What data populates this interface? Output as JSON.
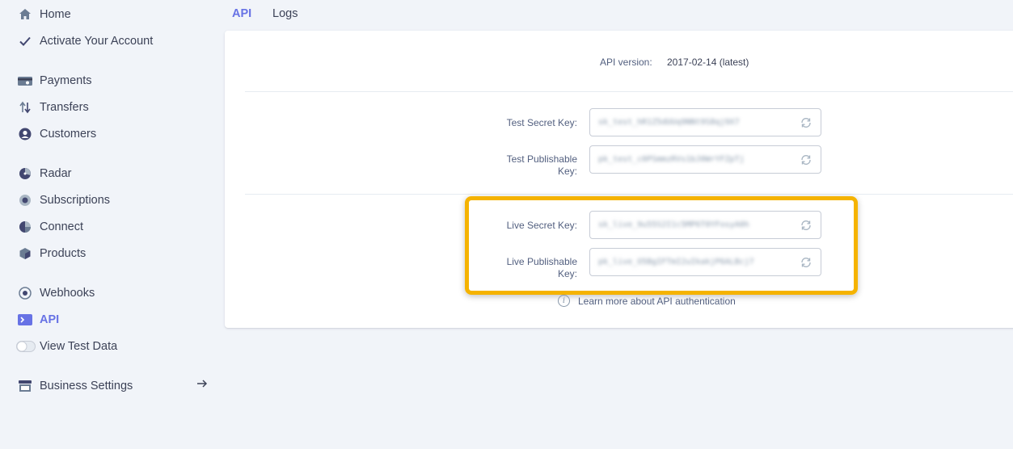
{
  "sidebar": {
    "items": [
      {
        "label": "Home",
        "icon": "home-icon"
      },
      {
        "label": "Activate Your Account",
        "icon": "check-icon"
      },
      {
        "label": "Payments",
        "icon": "payments-icon"
      },
      {
        "label": "Transfers",
        "icon": "transfers-icon"
      },
      {
        "label": "Customers",
        "icon": "customers-icon"
      },
      {
        "label": "Radar",
        "icon": "radar-icon"
      },
      {
        "label": "Subscriptions",
        "icon": "subscriptions-icon"
      },
      {
        "label": "Connect",
        "icon": "connect-icon"
      },
      {
        "label": "Products",
        "icon": "products-icon"
      },
      {
        "label": "Webhooks",
        "icon": "webhooks-icon"
      },
      {
        "label": "API",
        "icon": "api-icon",
        "active": true
      },
      {
        "label": "View Test Data",
        "icon": "toggle-icon",
        "toggle_on": false
      },
      {
        "label": "Business Settings",
        "icon": "store-icon"
      }
    ]
  },
  "tabs": [
    {
      "label": "API",
      "active": true
    },
    {
      "label": "Logs",
      "active": false
    }
  ],
  "api": {
    "version_label": "API version:",
    "version_value": "2017-02-14 (latest)",
    "test_secret_label": "Test Secret Key:",
    "test_secret_value": "sk_test_hR1Z5dUUq9NNt9S8qj9X7",
    "test_pub_label_1": "Test Publishable",
    "test_pub_label_2": "Key:",
    "test_pub_value": "pk_test_c0PSmmzRVs1bJ0WrYFZpTj",
    "live_secret_label": "Live Secret Key:",
    "live_secret_value": "sk_live_9u55S2I1c5MP6T0YFosyA0h",
    "live_pub_label_1": "Live Publishable",
    "live_pub_label_2": "Key:",
    "live_pub_value": "pk_live_O5BgIFTmI2uIkakjP6ALBcj7",
    "learn_more": "Learn more about API authentication"
  },
  "colors": {
    "accent": "#6772e5",
    "highlight": "#f5b300",
    "background": "#f1f4f9"
  }
}
